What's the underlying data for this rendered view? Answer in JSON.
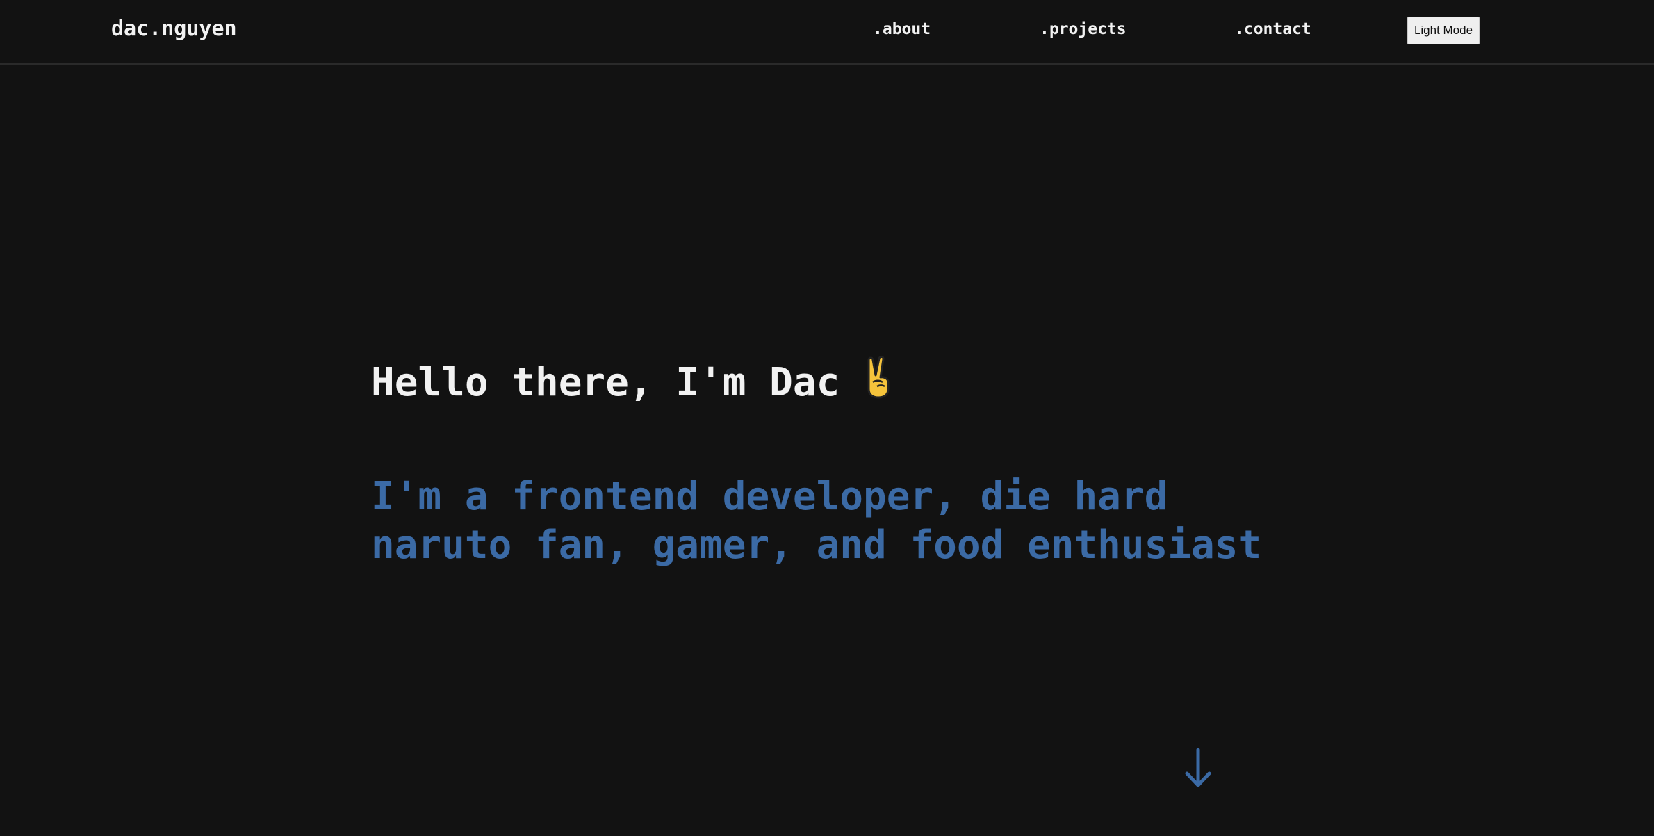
{
  "navbar": {
    "brand": "dac.nguyen",
    "links": [
      {
        "label": ".about"
      },
      {
        "label": ".projects"
      },
      {
        "label": ".contact"
      }
    ],
    "mode_toggle_label": "Light Mode"
  },
  "hero": {
    "greeting": "Hello there, I'm Dac",
    "greeting_icon": "victory-hand-emoji",
    "tagline": "I'm a frontend developer, die hard naruto fan, gamer, and food enthusiast",
    "scroll_icon": "arrow-down-icon"
  },
  "colors": {
    "background": "#121212",
    "text": "#f2f2f2",
    "accent": "#3b6aa5"
  }
}
